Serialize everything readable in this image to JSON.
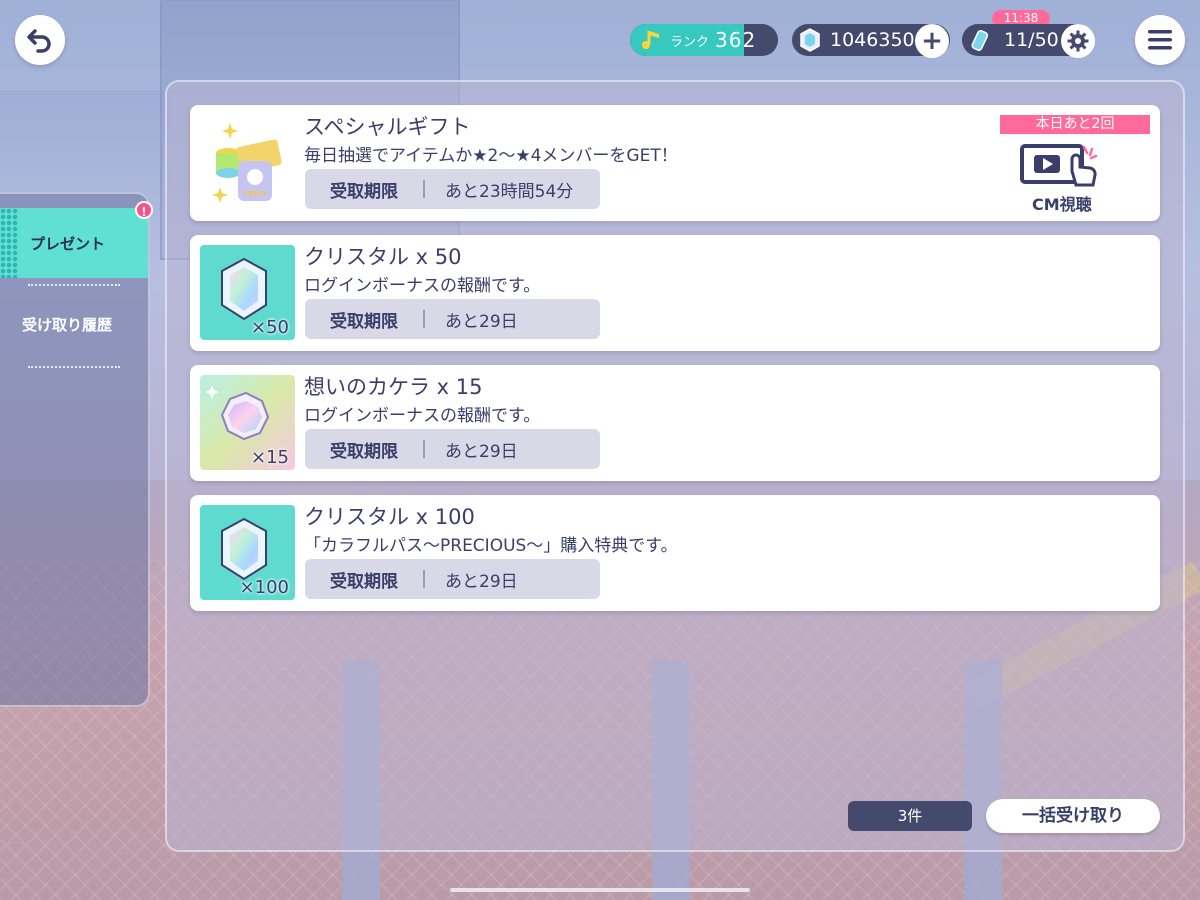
{
  "status_bar": {
    "rank_label": "ランク",
    "rank_value": "362",
    "rank_progress": 0.77,
    "crystal_count": "1046350",
    "plus_label": "+",
    "stamina_value": "11/50",
    "stamina_timer": "11:38"
  },
  "sidebar": {
    "tabs": [
      {
        "label": "プレゼント",
        "active": true,
        "alert": "!"
      },
      {
        "label": "受け取り履歴",
        "active": false
      }
    ]
  },
  "special_gift": {
    "title": "スペシャルギフト",
    "description": "毎日抽選でアイテムか★2〜★4メンバーをGET！",
    "deadline_label": "受取期限",
    "deadline_value": "あと23時間54分",
    "daily_badge": "本日あと2回",
    "cm_label": "CM視聴"
  },
  "presents": [
    {
      "title": "クリスタル x 50",
      "description": "ログインボーナスの報酬です。",
      "quantity": "×50",
      "icon": "crystal-icon",
      "deadline_label": "受取期限",
      "deadline_value": "あと29日"
    },
    {
      "title": "想いのカケラ x 15",
      "description": "ログインボーナスの報酬です。",
      "quantity": "×15",
      "icon": "memory-shard-icon",
      "deadline_label": "受取期限",
      "deadline_value": "あと29日"
    },
    {
      "title": "クリスタル x 100",
      "description": "「カラフルパス〜PRECIOUS〜」購入特典です。",
      "quantity": "×100",
      "icon": "crystal-icon",
      "deadline_label": "受取期限",
      "deadline_value": "あと29日"
    }
  ],
  "footer": {
    "count": "3件",
    "claim_all_label": "一括受け取り"
  },
  "colors": {
    "accent_teal": "#5fe0d2",
    "badge_pink": "#ff6a9a",
    "navy": "#434a6e"
  }
}
